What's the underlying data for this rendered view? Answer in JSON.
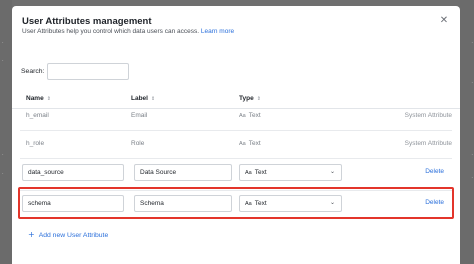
{
  "dialog": {
    "title": "User Attributes management",
    "subtitle": "User Attributes help you control which data users can access.",
    "learn_more": "Learn more",
    "close_icon": "close-icon"
  },
  "search": {
    "label": "Search:",
    "value": "",
    "placeholder": ""
  },
  "table": {
    "headers": {
      "name": "Name",
      "label": "Label",
      "type": "Type",
      "sort_icon": "⇕"
    },
    "system_rows": [
      {
        "name": "h_email",
        "label": "Email",
        "type": "Text",
        "type_icon": "Aa",
        "status": "System Attribute"
      },
      {
        "name": "h_role",
        "label": "Role",
        "type": "Text",
        "type_icon": "Aa",
        "status": "System Attribute"
      }
    ],
    "editable_rows": [
      {
        "name": "data_source",
        "label": "Data Source",
        "type": "Text",
        "type_icon": "Aa",
        "action": "Delete"
      },
      {
        "name": "schema",
        "label": "Schema",
        "type": "Text",
        "type_icon": "Aa",
        "action": "Delete"
      }
    ]
  },
  "add_button": {
    "label": "Add new User Attribute",
    "icon": "plus-icon"
  },
  "colors": {
    "accent": "#2a6fdb",
    "highlight": "#e3352b",
    "overlay": "#6f6f6f"
  }
}
